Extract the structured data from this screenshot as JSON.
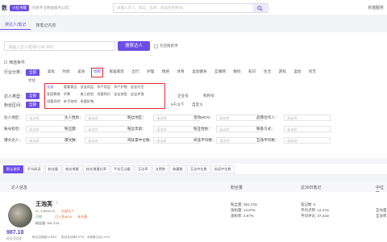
{
  "topbar": {
    "logo": "数",
    "version_badge": "小红书版",
    "tagline": "优质专业数据服务12年",
    "search_placeholder": "请输入达人、笔记、品牌、商品的名称/ID",
    "top_right": "充值服务"
  },
  "tabs": [
    {
      "label": "搜达人/笔记",
      "active": true
    },
    {
      "label": "搜笔记内容",
      "active": false
    }
  ],
  "search": {
    "placeholder": "请输入达人昵称/小红书ID",
    "button": "搜索达人",
    "checkbox": "包括搜索项"
  },
  "filters_title": "筛选条件",
  "industry": {
    "label": "行业分类：",
    "items": [
      "全部",
      "美妆",
      "时尚",
      "美食",
      "母婴",
      "家居家装",
      "出行",
      "护理",
      "情感",
      "体育",
      "运动健身",
      "互联网",
      "数码",
      "知识",
      "生活",
      "游戏",
      "运动",
      "综艺",
      "文化"
    ],
    "highlighted": "母婴",
    "all": "全部"
  },
  "wenhua": "文化",
  "sub": {
    "items": [
      "全部",
      "婴童食品",
      "宝宝用品",
      "孕产用品",
      "孕产护理",
      "宝宝才艺",
      "家庭教育",
      "早教",
      "育儿经验",
      "母婴知识",
      "宝宝穿搭",
      "宝宝护理",
      "母婴测评",
      "亲子游戏",
      "母婴好物"
    ]
  },
  "talent_type": {
    "label": "达人类型：",
    "all": "全部",
    "right": [
      "企业号",
      "机构号"
    ]
  },
  "fans_range": {
    "label": "粉丝区间：",
    "all": "全部",
    "right": [
      "5千以下",
      "自定义"
    ]
  },
  "filter_rows": [
    [
      {
        "label": "达人地区：",
        "value": "请选择"
      },
      {
        "label": "达人性别：",
        "value": "请选择"
      },
      {
        "label": "粉丝地区：",
        "value": "请选择"
      },
      {
        "label": "签约MCN：",
        "value": "请选择"
      },
      {
        "label": "品牌合作人：",
        "value": "请选择"
      }
    ],
    [
      {
        "label": "账号标签：",
        "value": "请选择"
      },
      {
        "label": "粉丝量：",
        "value": "请选择"
      },
      {
        "label": "粉丝年龄：",
        "value": "请选择"
      },
      {
        "label": "粉丝性别：",
        "value": "请选择"
      },
      {
        "label": "联系方式：",
        "value": "请选择"
      }
    ],
    [
      {
        "label": "爆文达人：",
        "value": "请选择"
      },
      {
        "label": "爆文数：",
        "value": "请选择"
      },
      {
        "label": "阅读量中位数：",
        "value": "请选择"
      },
      {
        "label": "阅读平均数：",
        "value": "请选择"
      },
      {
        "label": "互动平均数：",
        "value": "请选择"
      }
    ]
  ],
  "sort_tabs": [
    "默认排序",
    "平均阅读",
    "粉丝量",
    "粉丝增量",
    "粉丝增量比率",
    "平均互动量",
    "互动率",
    "点赞数",
    "收藏数",
    "互动中位数",
    "阅读中位数"
  ],
  "table": {
    "headers": [
      "达人信息",
      "粉丝量",
      "近30日笔记",
      "中位数"
    ]
  },
  "row": {
    "name": "王泡芙",
    "name_badge": "♀",
    "id": "ID: 43606478",
    "tag1": "头部达人",
    "location": "河南",
    "tag2": "已入驻MCN",
    "tag3": "未开通",
    "score": "987.18",
    "score_sub": "粉丝活跃度",
    "fans": "粉丝量: 391.27w",
    "likes": "涨粉量: 14.87w",
    "rate": "涨粉率: 3.97%",
    "notes": "笔记数: 5",
    "avg_read": "平均点赞: 12.47w",
    "avg_int": "平均评论: 37.22w",
    "lbl1": "互动量",
    "lbl2": "互动率",
    "bottom_left": "粉丝活跃度13.80%",
    "bottom_mid": "粉丝互动率5.47%",
    "bottom_right": "水粉数占比1.47%"
  }
}
